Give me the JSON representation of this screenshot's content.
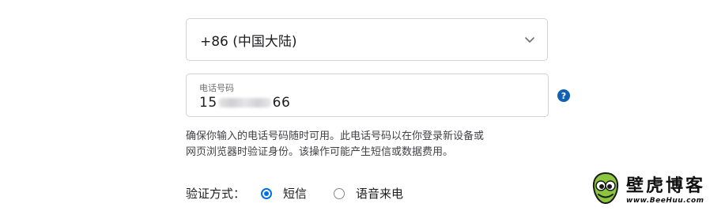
{
  "country_select": {
    "value": "+86 (中国大陆)",
    "icon": "chevron-down-icon"
  },
  "phone_field": {
    "label": "电话号码",
    "value_prefix": "15",
    "value_suffix": "66"
  },
  "help_icon": {
    "glyph": "?",
    "color": "#1060b4"
  },
  "note": {
    "line1": "确保你输入的电话号码随时可用。此电话号码以在你登录新设备或",
    "line2": "网页浏览器时验证身份。该操作可能产生短信或数据费用。"
  },
  "verification": {
    "label": "验证方式：",
    "options": [
      {
        "label": "短信",
        "selected": true
      },
      {
        "label": "语音来电",
        "selected": false
      }
    ],
    "accent": "#0071e3"
  },
  "watermark": {
    "cn": "壁虎博客",
    "en": "www.BeeHuu.com"
  }
}
